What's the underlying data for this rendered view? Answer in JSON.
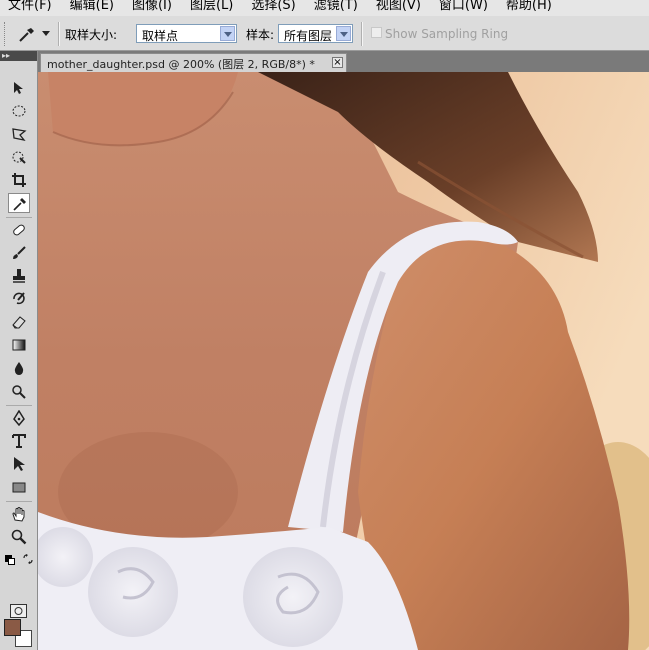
{
  "menu": [
    "文件(F)",
    "编辑(E)",
    "图像(I)",
    "图层(L)",
    "选择(S)",
    "滤镜(T)",
    "视图(V)",
    "窗口(W)",
    "帮助(H)"
  ],
  "options": {
    "tool_icon": "eyedropper-icon",
    "sample_size_label": "取样大小:",
    "sample_size_value": "取样点",
    "sample_label": "样本:",
    "sample_value": "所有图层",
    "show_sampling_ring_label": "Show Sampling Ring",
    "show_sampling_ring_checked": false
  },
  "document": {
    "tab_title": "mother_daughter.psd @ 200% (图层 2, RGB/8*) *",
    "close_icon": "close-icon"
  },
  "toolbox": {
    "tools": [
      "move-icon",
      "marquee-icon",
      "lasso-icon",
      "quick-select-icon",
      "crop-icon",
      "eyedropper-icon",
      "healing-brush-icon",
      "brush-icon",
      "clone-stamp-icon",
      "history-brush-icon",
      "eraser-icon",
      "gradient-icon",
      "blur-icon",
      "dodge-icon",
      "pen-icon",
      "type-icon",
      "path-select-icon",
      "rectangle-icon",
      "hand-icon",
      "zoom-icon"
    ],
    "active_tool": "eyedropper-icon",
    "foreground_color": "#8a5a45",
    "background_color": "#ffffff"
  }
}
